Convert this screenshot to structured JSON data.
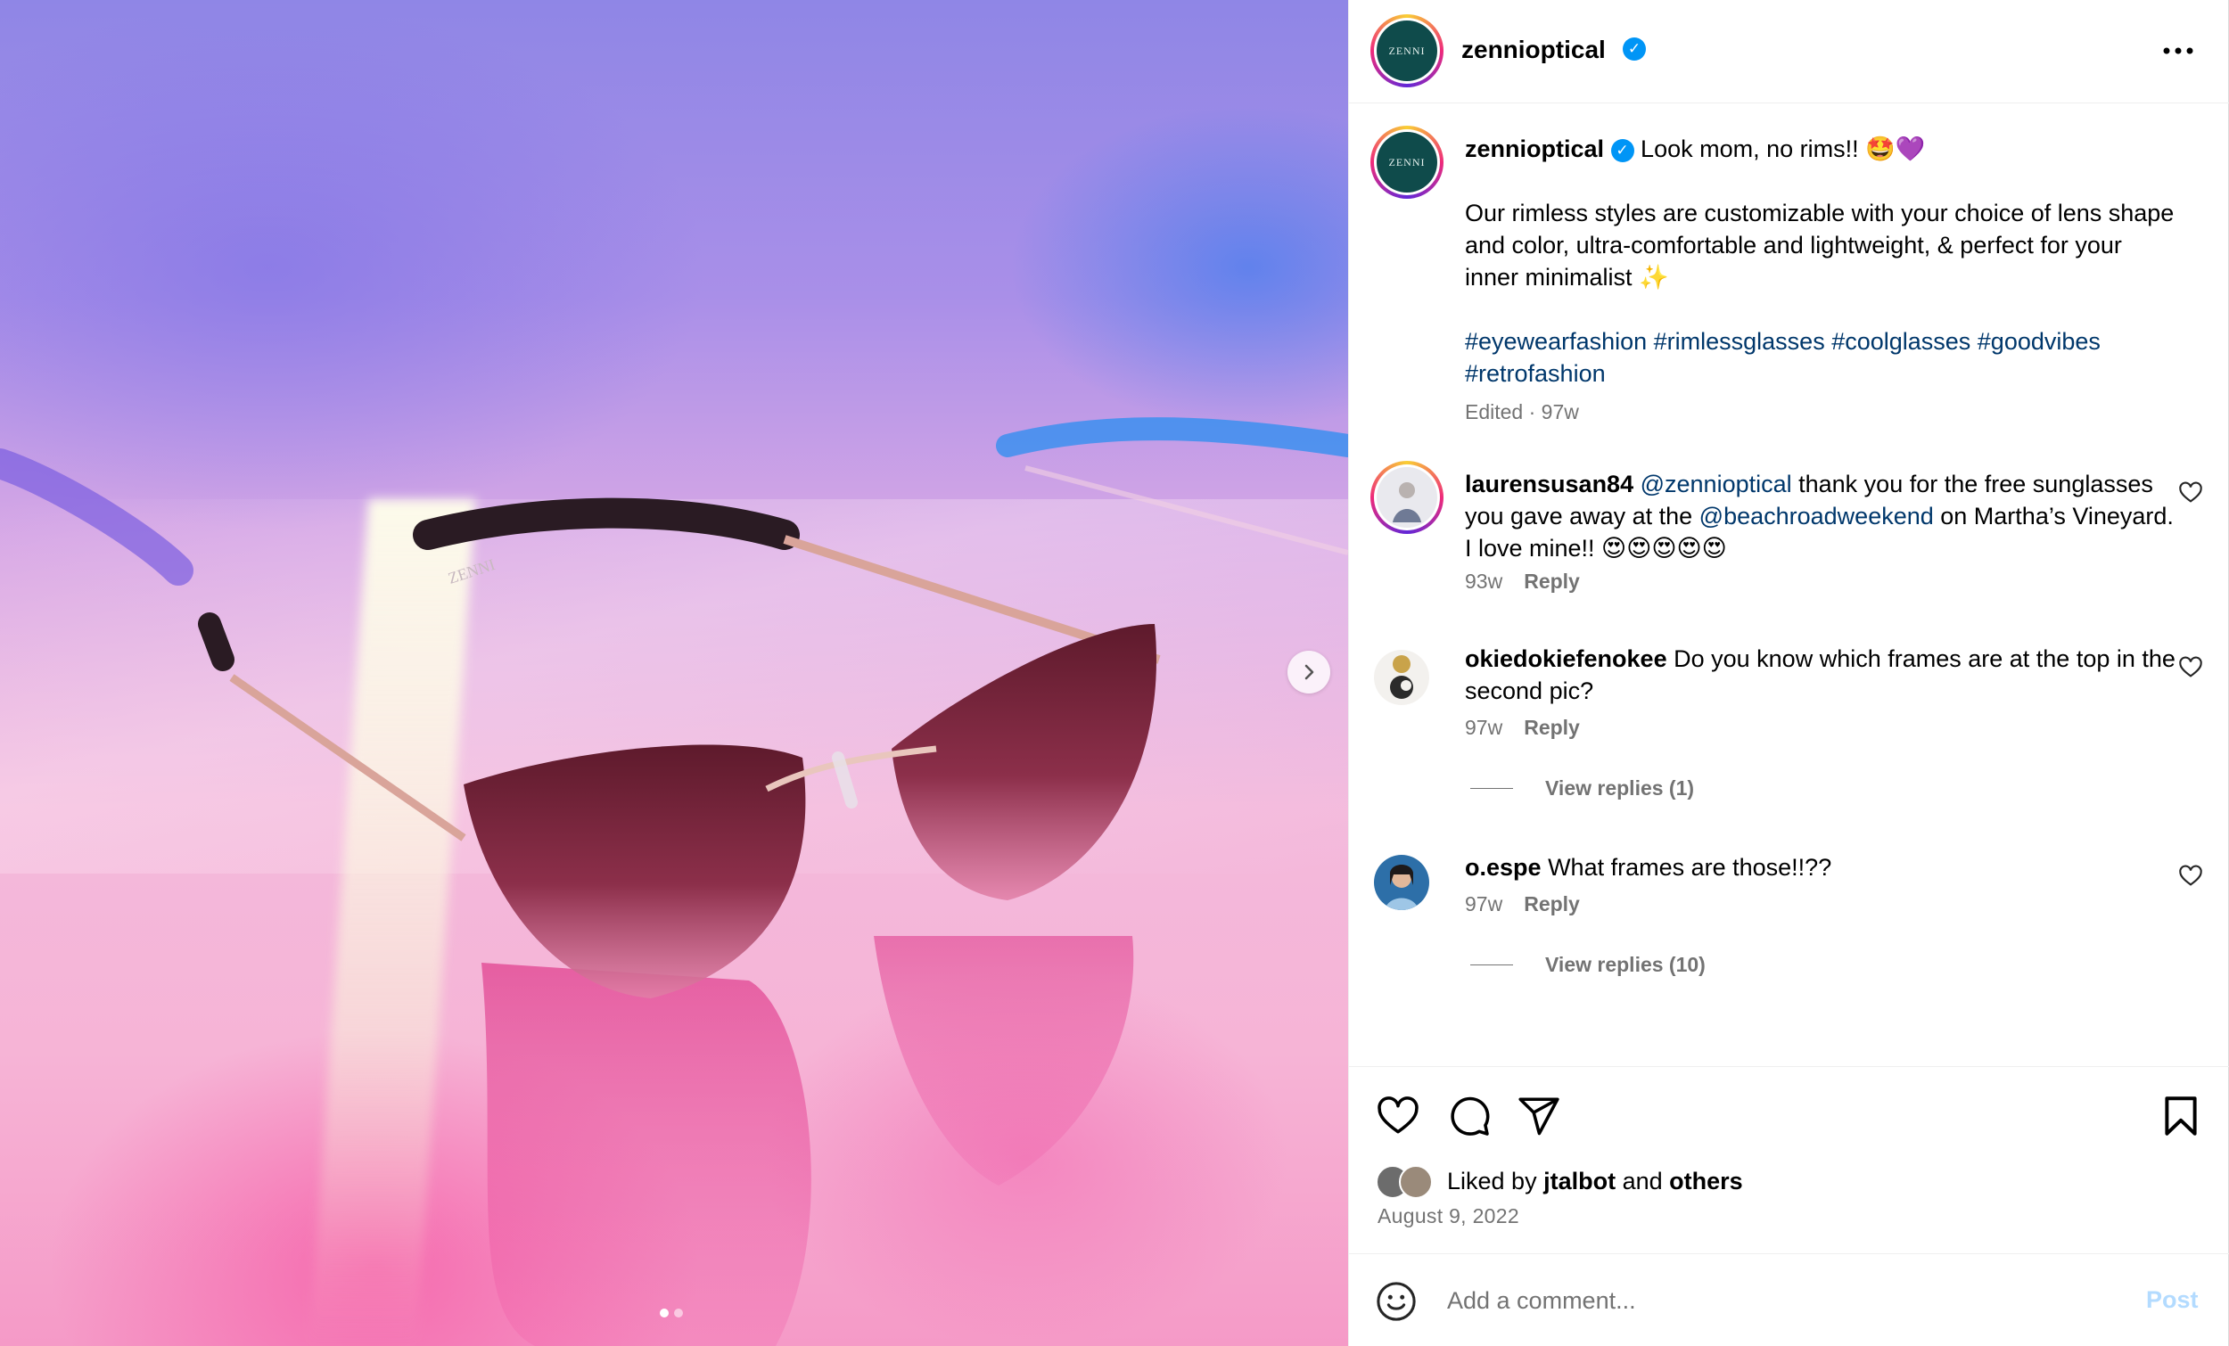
{
  "post": {
    "author": "zennioptical",
    "avatar_text": "ZENNI",
    "verified_mark": "✓",
    "more_label": "•••"
  },
  "caption": {
    "username": "zennioptical",
    "line1": "Look mom, no rims!! 🤩💜",
    "body": "Our rimless styles are customizable with your choice of lens shape and color, ultra-comfortable and lightweight, & perfect for your inner minimalist ✨",
    "hashtags": "#eyewearfashion #rimlessglasses #coolglasses #goodvibes #retrofashion",
    "meta": "Edited · 97w"
  },
  "comments": [
    {
      "username": "laurensusan84",
      "mention1": "@zennioptical",
      "text1": " thank you for the free sunglasses you gave away at the ",
      "mention2": "@beachroadweekend",
      "text2": " on Martha’s Vineyard. I love mine!! 😍😍😍😍😍",
      "age": "93w",
      "reply_label": "Reply"
    },
    {
      "username": "okiedokiefenokee",
      "text": "Do you know which frames are at the top in the second pic?",
      "age": "97w",
      "reply_label": "Reply",
      "view_replies": "View replies (1)"
    },
    {
      "username": "o.espe",
      "text": "What frames are those!!??",
      "age": "97w",
      "reply_label": "Reply",
      "view_replies": "View replies (10)"
    }
  ],
  "likes": {
    "prefix": "Liked by ",
    "user": "jtalbot",
    "middle": " and ",
    "others": "others"
  },
  "date": "August 9, 2022",
  "comment_box": {
    "placeholder": "Add a comment...",
    "post_label": "Post"
  },
  "media": {
    "slide_count": 2,
    "active_slide": 1,
    "frame_text": "ZENNI"
  },
  "colors": {
    "verified": "#0095f6",
    "link": "#00376b",
    "muted": "#737373",
    "post_disabled": "#b3dbff",
    "logo_bg": "#0f4b4b"
  }
}
